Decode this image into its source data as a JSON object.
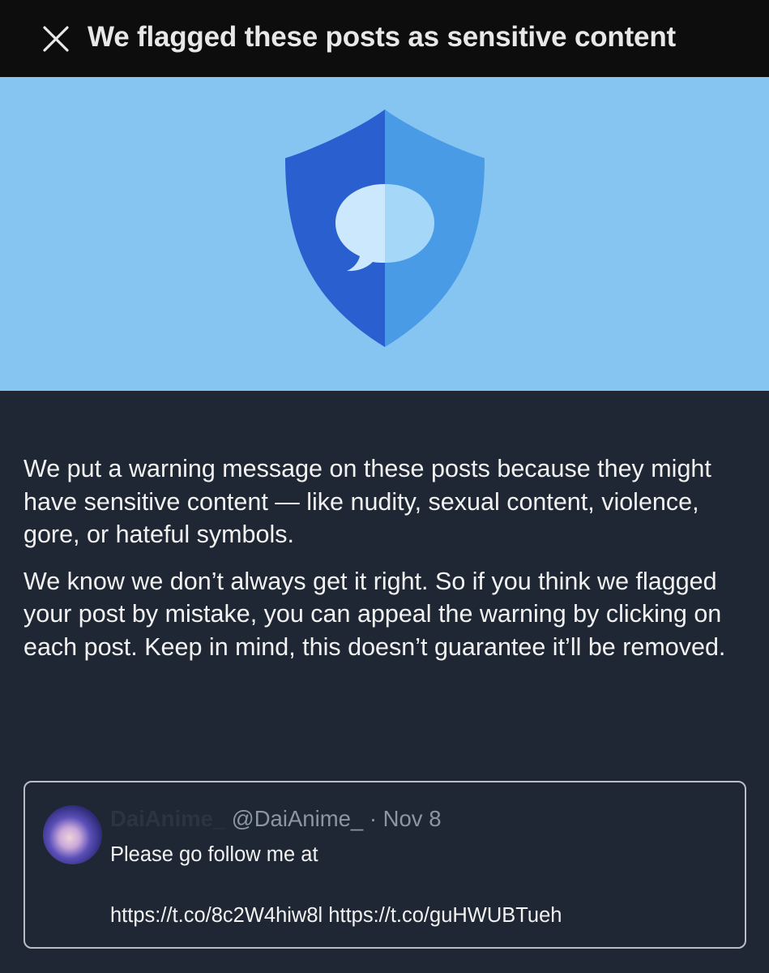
{
  "header": {
    "title": "We flagged these posts as sensitive content",
    "close_icon": "close-icon"
  },
  "banner": {
    "icon": "shield-chat-icon",
    "colors": {
      "background": "#86c5f2",
      "shield_dark": "#2a5fcf",
      "shield_light": "#4a9be6",
      "bubble_left": "#cbe8fd",
      "bubble_right": "#a5d8f8"
    }
  },
  "body": {
    "paragraph_1": "We put a warning message on these posts because they might have sensitive content — like nudity, sexual content, violence, gore, or hateful symbols.",
    "paragraph_2": "We know we don’t always get it right. So if you think we flagged your post by mistake, you can appeal the warning by clicking on each post. Keep in mind, this doesn’t guarantee it’ll be removed."
  },
  "post": {
    "author_name": "DaiAnime_",
    "author_handle": "@DaiAnime_",
    "separator": "·",
    "date": "Nov 8",
    "text": "Please go follow me at",
    "link_1": "https://t.co/8c2W4hiw8l",
    "link_2": "https://t.co/guHWUBTueh"
  }
}
